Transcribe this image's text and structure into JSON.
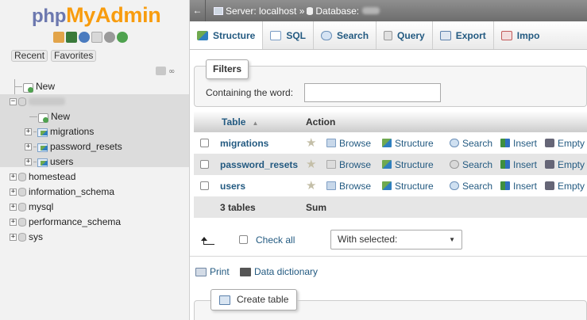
{
  "logo": {
    "php": "php",
    "myadmin": "MyAdmin"
  },
  "nav": {
    "recent_label": "Recent",
    "favorites_label": "Favorites",
    "link_icon": "∞",
    "tree": {
      "new_label": "New",
      "current_db_children": [
        {
          "label": "New"
        },
        {
          "label": "migrations"
        },
        {
          "label": "password_resets"
        },
        {
          "label": "users"
        }
      ],
      "databases": [
        "homestead",
        "information_schema",
        "mysql",
        "performance_schema",
        "sys"
      ]
    }
  },
  "topbar": {
    "back_icon": "←",
    "breadcrumb_server": "Server: localhost »",
    "breadcrumb_database": "Database:"
  },
  "tabs": [
    {
      "label": "Structure",
      "icon": "structure-icon",
      "active": true
    },
    {
      "label": "SQL",
      "icon": "sql-icon"
    },
    {
      "label": "Search",
      "icon": "search-icon"
    },
    {
      "label": "Query",
      "icon": "query-icon"
    },
    {
      "label": "Export",
      "icon": "export-icon"
    },
    {
      "label": "Impo",
      "icon": "import-icon"
    }
  ],
  "filters": {
    "legend": "Filters",
    "label": "Containing the word:",
    "value": ""
  },
  "table": {
    "headers": {
      "table": "Table",
      "sort": "▲",
      "action": "Action"
    },
    "rows": [
      {
        "name": "migrations"
      },
      {
        "name": "password_resets"
      },
      {
        "name": "users"
      }
    ],
    "actions": {
      "browse": "Browse",
      "structure": "Structure",
      "search": "Search",
      "insert": "Insert",
      "empty": "Empty"
    },
    "footer": {
      "count": "3 tables",
      "sum": "Sum"
    }
  },
  "bulk": {
    "check_all": "Check all",
    "with_selected": "With selected:",
    "caret": "▼"
  },
  "links": {
    "print": "Print",
    "data_dictionary": "Data dictionary"
  },
  "create_table": {
    "label": "Create table"
  },
  "colors": {
    "link": "#235a81",
    "logo_php": "#6c78af",
    "logo_myadmin": "#f89c0e",
    "topbar": "#7d7d7d"
  }
}
